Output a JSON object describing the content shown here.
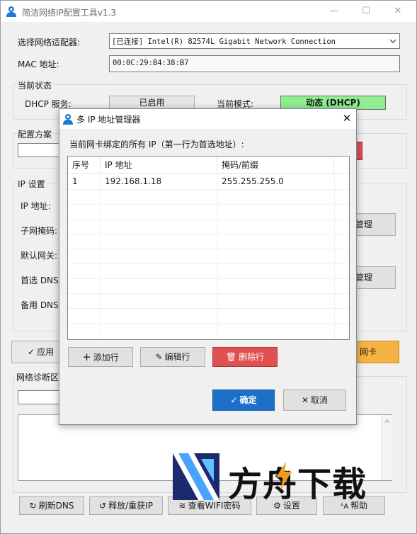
{
  "app": {
    "title": "简洁网络IP配置工具v1.3",
    "controls": {
      "minimize": "—",
      "maximize": "☐",
      "close": "✕"
    }
  },
  "adapter": {
    "label": "选择网络适配器:",
    "selected": "[已连接] Intel(R) 82574L Gigabit Network Connection"
  },
  "mac": {
    "label": "MAC 地址:",
    "value": "00:0C:29:B4:38:B7"
  },
  "status": {
    "group_title": "当前状态",
    "dhcp_label": "DHCP 服务:",
    "dhcp_value": "已启用",
    "mode_label": "当前模式:",
    "mode_value": "动态 (DHCP)",
    "mode_color": "#90ee90"
  },
  "profile": {
    "group_title": "配置方案"
  },
  "ip_settings": {
    "group_title": "IP 设置",
    "ip_label": "IP 地址:",
    "mask_label": "子网掩码:",
    "gateway_label": "默认网关:",
    "dns1_label": "首选 DNS:",
    "dns2_label": "备用 DNS:",
    "manage_ip_label": "管理",
    "manage_dns_label": "管理"
  },
  "actions": {
    "apply_label": "应用",
    "card_label": "网卡",
    "card_color": "#f5b342"
  },
  "diagnostics": {
    "group_title": "网络诊断区"
  },
  "bottom_buttons": {
    "flush_dns": "刷新DNS",
    "release_renew": "释放/重获IP",
    "wifi_password": "查看WIFI密码",
    "settings": "设置",
    "help": "帮助"
  },
  "dialog": {
    "title": "多 IP 地址管理器",
    "description": "当前网卡绑定的所有 IP（第一行为首选地址）:",
    "columns": [
      "序号",
      "IP 地址",
      "掩码/前缀"
    ],
    "rows": [
      {
        "index": "1",
        "ip": "192.168.1.18",
        "mask": "255.255.255.0"
      }
    ],
    "add_label": "添加行",
    "edit_label": "编辑行",
    "delete_label": "删除行",
    "delete_color": "#e05050",
    "ok_label": "确定",
    "ok_color": "#1e6fc8",
    "cancel_label": "取消"
  },
  "watermark": {
    "text": "方舟下载"
  }
}
